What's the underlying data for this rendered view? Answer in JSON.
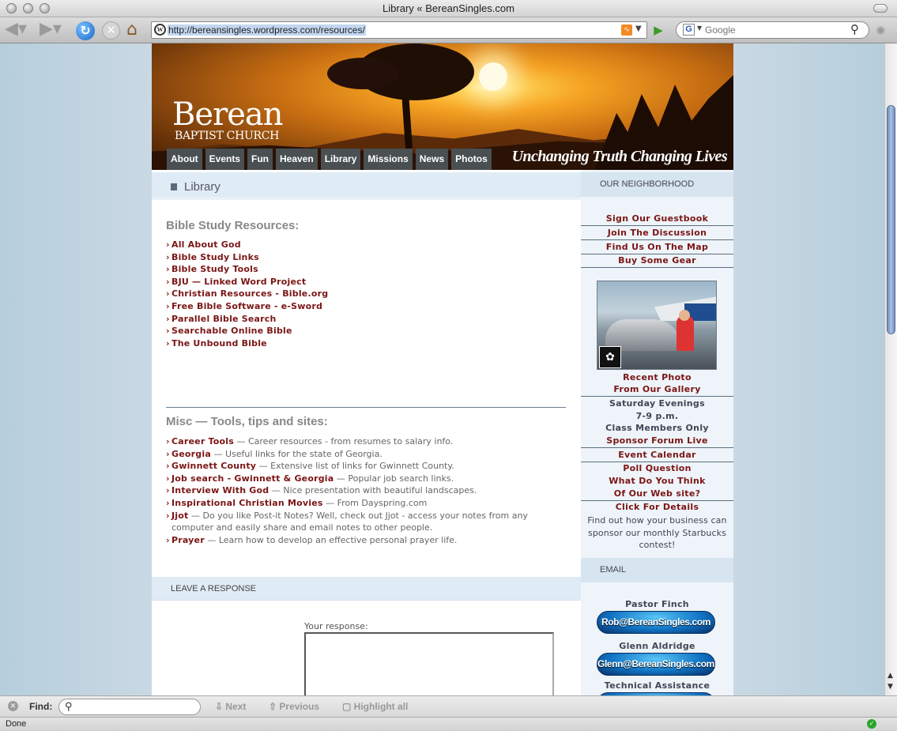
{
  "window": {
    "title": "Library « BereanSingles.com"
  },
  "toolbar": {
    "back_icon": "back-arrow-icon",
    "forward_icon": "forward-arrow-icon",
    "url": "http://bereansingles.wordpress.com/resources/",
    "search_engine": "G",
    "search_placeholder": "Google"
  },
  "header": {
    "logo_main": "Berean",
    "logo_sub": "BAPTIST CHURCH",
    "tagline": "Unchanging Truth Changing Lives",
    "nav": [
      "About",
      "Events",
      "Fun",
      "Heaven",
      "Library",
      "Missions",
      "News",
      "Photos"
    ]
  },
  "content": {
    "title": "Library",
    "section1_title": "Bible Study Resources:",
    "resources": [
      "All About God",
      "Bible Study Links",
      "Bible Study Tools",
      "BJU — Linked Word Project",
      "Christian Resources - Bible.org",
      "Free Bible Software - e-Sword",
      "Parallel Bible Search",
      "Searchable Online Bible",
      "The Unbound Bible"
    ],
    "section2_title": "Misc — Tools, tips and sites:",
    "misc": [
      {
        "link": "Career Tools",
        "desc": " — Career resources - from resumes to salary info."
      },
      {
        "link": "Georgia",
        "desc": " — Useful links for the state of Georgia."
      },
      {
        "link": "Gwinnett County",
        "desc": " — Extensive list of links for Gwinnett County."
      },
      {
        "link": "Job search - Gwinnett & Georgia",
        "desc": " — Popular job search links."
      },
      {
        "link": "Interview With God",
        "desc": " — Nice presentation with beautiful landscapes."
      },
      {
        "link": "Inspirational Christian Movies",
        "desc": " — From Dayspring.com"
      },
      {
        "link": "Jjot",
        "desc": " — Do you like Post-it Notes? Well, check out Jjot - access your notes from any computer and easily share and email notes to other people."
      },
      {
        "link": "Prayer",
        "desc": " — Learn how to develop an effective personal prayer life."
      }
    ],
    "leave_response": "LEAVE A RESPONSE",
    "response_label": "Your response:"
  },
  "sidebar": {
    "neighborhood_title": "OUR NEIGHBORHOOD",
    "guestbook": "Sign Our Guestbook",
    "discussion": "Join The Discussion",
    "map": "Find Us On The Map",
    "gear": "Buy Some Gear",
    "recent_photo_1": "Recent Photo",
    "recent_photo_2": "From Our Gallery",
    "saturday": "Saturday Evenings",
    "time": "7-9 p.m.",
    "members": "Class Members Only",
    "forum": "Sponsor Forum Live",
    "calendar": "Event Calendar",
    "poll": "Poll Question",
    "what_think": "What Do You Think",
    "website": "Of Our Web site?",
    "details": "Click For Details",
    "sponsor_text": "Find out how your business can sponsor our monthly Starbucks contest!",
    "email_title": "EMAIL",
    "pastor": "Pastor Finch",
    "pastor_email": "Rob@BereanSingles.com",
    "glenn": "Glenn Aldridge",
    "glenn_email": "Glenn@BereanSingles.com",
    "tech": "Technical Assistance"
  },
  "findbar": {
    "label": "Find:",
    "next": "Next",
    "previous": "Previous",
    "highlight": "Highlight all"
  },
  "statusbar": {
    "text": "Done"
  },
  "colors": {
    "link": "#7b1515",
    "nav_bg": "#4a4f52",
    "header_band": "#e0ecf5",
    "email_button": "#1173c4"
  }
}
